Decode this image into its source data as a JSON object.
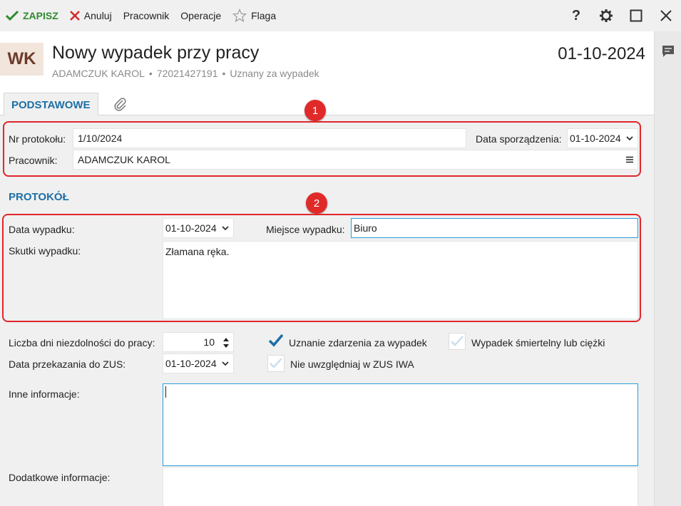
{
  "toolbar": {
    "save_label": "ZAPISZ",
    "cancel_label": "Anuluj",
    "employee_label": "Pracownik",
    "operations_label": "Operacje",
    "flag_label": "Flaga"
  },
  "header": {
    "avatar": "WK",
    "title": "Nowy wypadek przy pracy",
    "employee": "ADAMCZUK KAROL",
    "pesel": "72021427191",
    "status": "Uznany za wypadek",
    "date": "01-10-2024"
  },
  "tabs": {
    "basic": "PODSTAWOWE"
  },
  "basic": {
    "protocol_no_label": "Nr protokołu:",
    "protocol_no": "1/10/2024",
    "prepared_date_label": "Data sporządzenia:",
    "prepared_date": "01-10-2024",
    "employee_label": "Pracownik:",
    "employee": "ADAMCZUK KAROL"
  },
  "protocol": {
    "section_title": "PROTOKÓŁ",
    "accident_date_label": "Data wypadku:",
    "accident_date": "01-10-2024",
    "place_label": "Miejsce wypadku:",
    "place": "Biuro",
    "effects_label": "Skutki wypadku:",
    "effects": "Złamana ręka.",
    "sick_days_label": "Liczba dni niezdolności do pracy:",
    "sick_days": "10",
    "zus_date_label": "Data przekazania do ZUS:",
    "zus_date": "01-10-2024",
    "recognition_label": "Uznanie zdarzenia za wypadek",
    "recognition_checked": true,
    "fatal_label": "Wypadek śmiertelny lub ciężki",
    "fatal_checked": false,
    "exclude_zus_label": "Nie uwzględniaj w ZUS IWA",
    "exclude_zus_checked": false,
    "other_info_label": "Inne informacje:",
    "other_info": "",
    "additional_info_label": "Dodatkowe informacje:",
    "additional_info": ""
  },
  "annotations": {
    "badge1": "1",
    "badge2": "2"
  },
  "colors": {
    "accent": "#1d6fa5",
    "save_green": "#2f8a2f",
    "cancel_red": "#d42b2b",
    "annotation_red": "#e0262b",
    "focus_blue": "#2a9fd8"
  }
}
